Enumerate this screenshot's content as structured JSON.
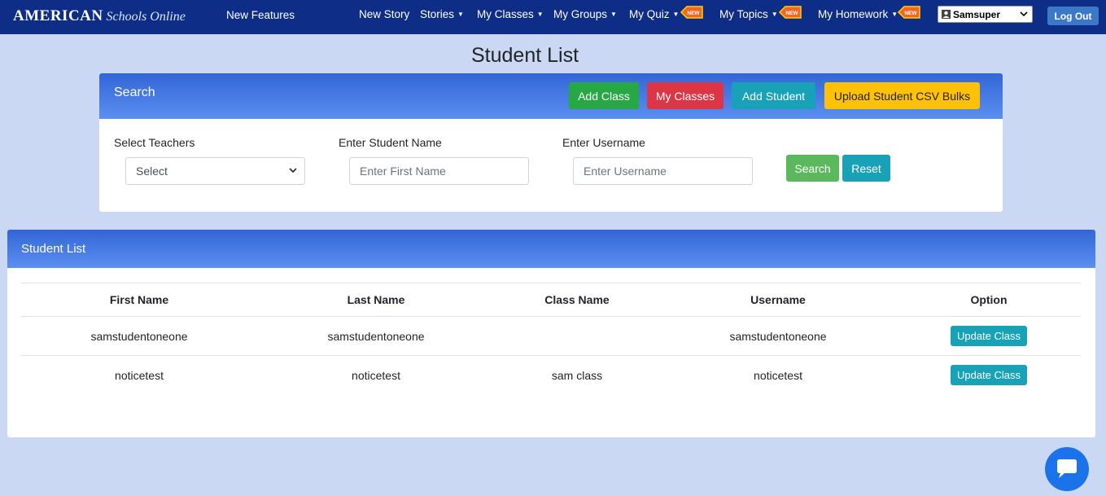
{
  "nav": {
    "brand_bold": "AMERICAN",
    "brand_script": "Schools Online",
    "new_features": "New Features",
    "items": [
      {
        "label": "New Story",
        "caret": false,
        "new": false
      },
      {
        "label": "Stories",
        "caret": true,
        "new": false
      },
      {
        "label": "My Classes",
        "caret": true,
        "new": false
      },
      {
        "label": "My Groups",
        "caret": true,
        "new": false
      },
      {
        "label": "My Quiz",
        "caret": true,
        "new": true
      },
      {
        "label": "My Topics",
        "caret": true,
        "new": true
      },
      {
        "label": "My Homework",
        "caret": true,
        "new": true
      }
    ],
    "badge_text": "NEW",
    "user": "Samsuper",
    "logout": "Log Out"
  },
  "page_title": "Student List",
  "search": {
    "title": "Search",
    "buttons": {
      "add_class": "Add Class",
      "my_classes": "My Classes",
      "add_student": "Add Student",
      "upload_csv": "Upload Student CSV Bulks"
    },
    "teachers_label": "Select Teachers",
    "teachers_value": "Select",
    "student_label": "Enter Student Name",
    "student_placeholder": "Enter First Name",
    "username_label": "Enter Username",
    "username_placeholder": "Enter Username",
    "search_btn": "Search",
    "reset_btn": "Reset"
  },
  "list": {
    "title": "Student List",
    "columns": [
      "First Name",
      "Last Name",
      "Class Name",
      "Username",
      "Option"
    ],
    "rows": [
      {
        "first": "samstudentoneone",
        "last": "samstudentoneone",
        "class": "",
        "username": "samstudentoneone",
        "option": "Update Class"
      },
      {
        "first": "noticetest",
        "last": "noticetest",
        "class": "sam class",
        "username": "noticetest",
        "option": "Update Class"
      }
    ]
  },
  "colors": {
    "nav_bg": "#0e2d86",
    "page_bg": "#cbd8f4",
    "add_class": "#28a745",
    "my_classes": "#dc3545",
    "add_student": "#17a2b8",
    "upload_csv": "#ffc107",
    "search_btn": "#5cb85c",
    "reset_btn": "#17a2b8"
  }
}
